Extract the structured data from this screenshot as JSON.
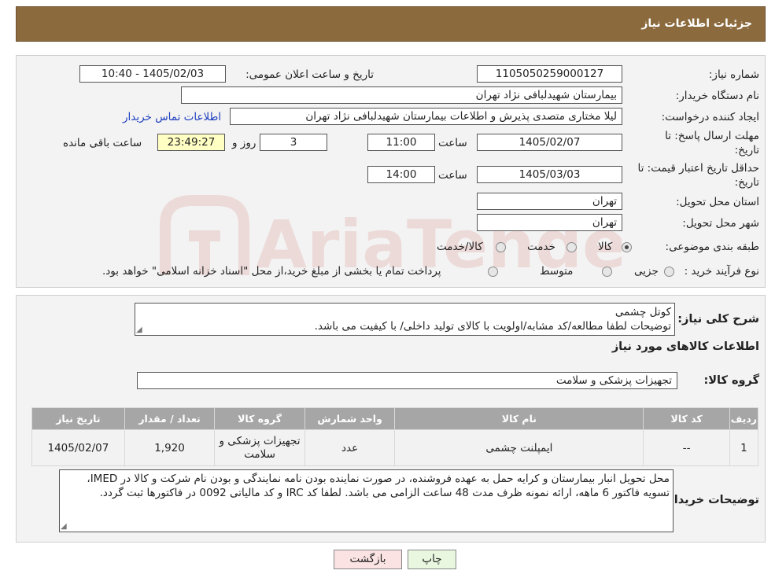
{
  "header": {
    "title": "جزئیات اطلاعات نیاز"
  },
  "form": {
    "need_number_label": "شماره نیاز:",
    "need_number": "1105050259000127",
    "announce_label": "تاریخ و ساعت اعلان عمومی:",
    "announce_value": "1405/02/03 - 10:40",
    "buyer_org_label": "نام دستگاه خریدار:",
    "buyer_org": "بیمارستان شهیدلبافی نژاد تهران",
    "creator_label": "ایجاد کننده درخواست:",
    "creator": "لیلا مختاری متصدی پذیرش و اطلاعات بیمارستان شهیدلبافی نژاد تهران",
    "contact_link": "اطلاعات تماس خریدار",
    "deadline_label_1": "مهلت ارسال پاسخ: تا",
    "deadline_label_2": "تاریخ:",
    "deadline_date": "1405/02/07",
    "time_label": "ساعت",
    "deadline_time": "11:00",
    "days_value": "3",
    "days_label": "روز و",
    "remaining_time": "23:49:27",
    "remaining_label": "ساعت باقی مانده",
    "validity_label_1": "حداقل تاریخ اعتبار قیمت: تا",
    "validity_label_2": "تاریخ:",
    "validity_date": "1405/03/03",
    "validity_time": "14:00",
    "province_label": "استان محل تحویل:",
    "province": "تهران",
    "city_label": "شهر محل تحویل:",
    "city": "تهران",
    "category_label": "طبقه بندی موضوعی:",
    "category_options": [
      "کالا",
      "خدمت",
      "کالا/خدمت"
    ],
    "category_selected": "کالا",
    "process_label": "نوع فرآیند خرید :",
    "process_options": [
      "جزیی",
      "متوسط"
    ],
    "process_note": "پرداخت تمام یا بخشی از مبلغ خرید،از محل \"اسناد خزانه اسلامی\" خواهد بود."
  },
  "need": {
    "summary_label": "شرح کلی نیاز:",
    "summary_line1": "کوتل چشمی",
    "summary_line2": "توضیحات لطفا مطالعه/کد مشابه/اولویت با کالای تولید داخلی/ با کیفیت می باشد.",
    "goods_info_title": "اطلاعات کالاهای مورد نیاز",
    "group_label": "گروه کالا:",
    "group_value": "تجهیزات پزشکی و سلامت"
  },
  "table": {
    "headers": [
      "ردیف",
      "کد کالا",
      "نام کالا",
      "واحد شمارش",
      "گروه کالا",
      "تعداد / مقدار",
      "تاریخ نیاز"
    ],
    "rows": [
      [
        "1",
        "--",
        "ایمپلنت چشمی",
        "عدد",
        "تجهیزات پزشکی و سلامت",
        "1,920",
        "1405/02/07"
      ]
    ]
  },
  "buyer_notes": {
    "label": "توضیحات خریدار:",
    "text": "محل تحویل انبار بیمارستان و کرایه حمل به عهده فروشنده، در صورت نماینده بودن نامه نمایندگی و بودن نام شرکت و کالا در IMED، تسویه فاکتور 6 ماهه، ارائه نمونه ظرف مدت 48 ساعت الزامی می باشد. لطفا کد IRC و کد مالیاتی 0092 در فاکتورها ثبت گردد."
  },
  "buttons": {
    "print": "چاپ",
    "back": "بازگشت"
  },
  "colors": {
    "header_bg": "#8b6a3e",
    "print_bg": "#eaf7e0",
    "back_bg": "#fbe3e3",
    "table_header": "#a6a6a6"
  }
}
